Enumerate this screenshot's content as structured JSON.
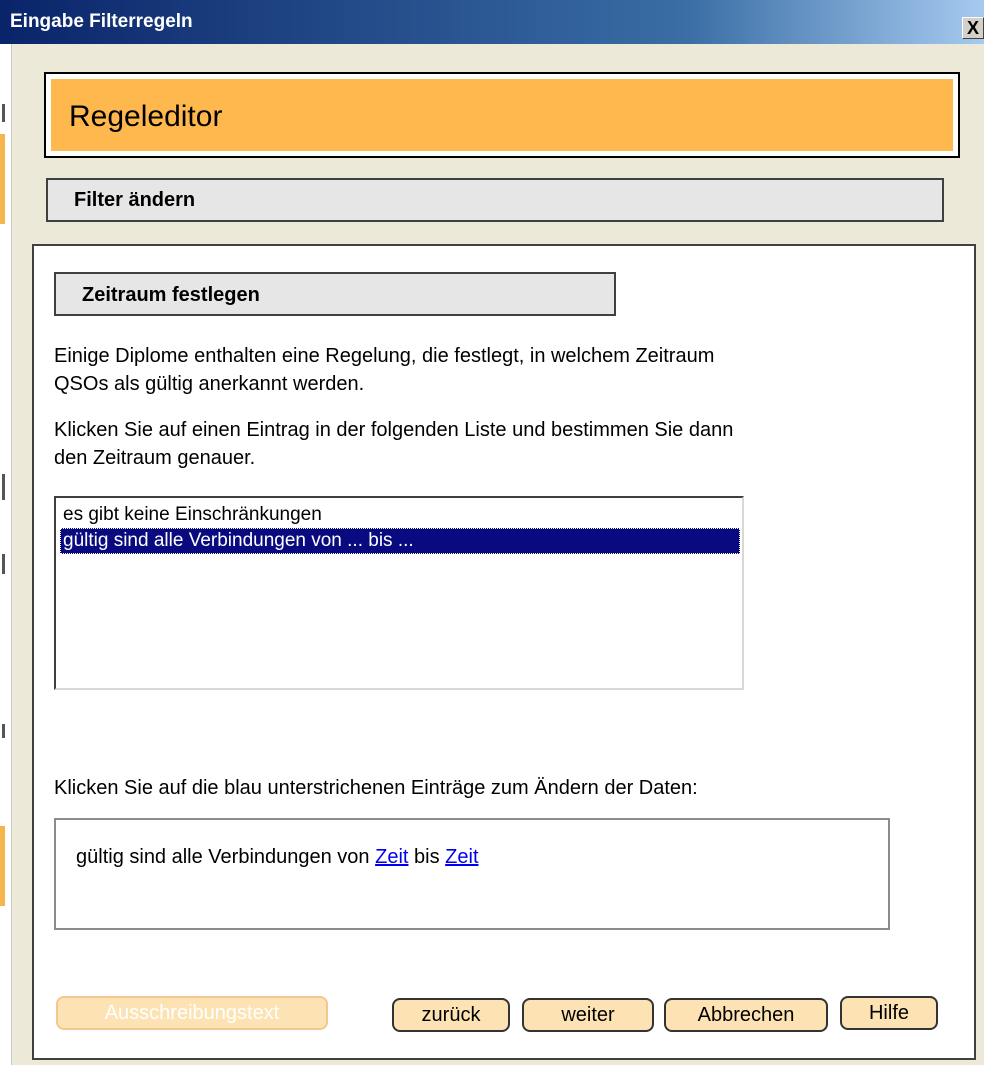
{
  "window": {
    "title": "Eingabe Filterregeln",
    "close_label": "X"
  },
  "header": {
    "title": "Regeleditor"
  },
  "subheader": {
    "title": "Filter ändern"
  },
  "section": {
    "title": "Zeitraum festlegen",
    "intro_line1": "Einige Diplome enthalten eine Regelung, die festlegt, in welchem Zeitraum",
    "intro_line2": "QSOs als gültig anerkannt werden.",
    "instruction_line1": "Klicken Sie auf einen Eintrag in der folgenden Liste und bestimmen Sie dann",
    "instruction_line2": "den Zeitraum genauer."
  },
  "list": {
    "items": [
      {
        "label": "es gibt keine Einschränkungen",
        "selected": false
      },
      {
        "label": "gültig sind alle Verbindungen von ... bis ...",
        "selected": true
      }
    ]
  },
  "rule": {
    "hint": "Klicken Sie auf die blau unterstrichenen Einträge zum Ändern der Daten:",
    "prefix": "gültig sind alle Verbindungen von",
    "link1": "Zeit",
    "middle": "bis",
    "link2": "Zeit"
  },
  "buttons": {
    "ausschreibung": "Ausschreibungstext",
    "zurueck": "zurück",
    "weiter": "weiter",
    "abbrechen": "Abbrechen",
    "hilfe": "Hilfe"
  },
  "colors": {
    "header_bg": "#ffb84d",
    "selection": "#0a0a80",
    "link": "#0000ee",
    "button_bg": "#fde3b4"
  }
}
